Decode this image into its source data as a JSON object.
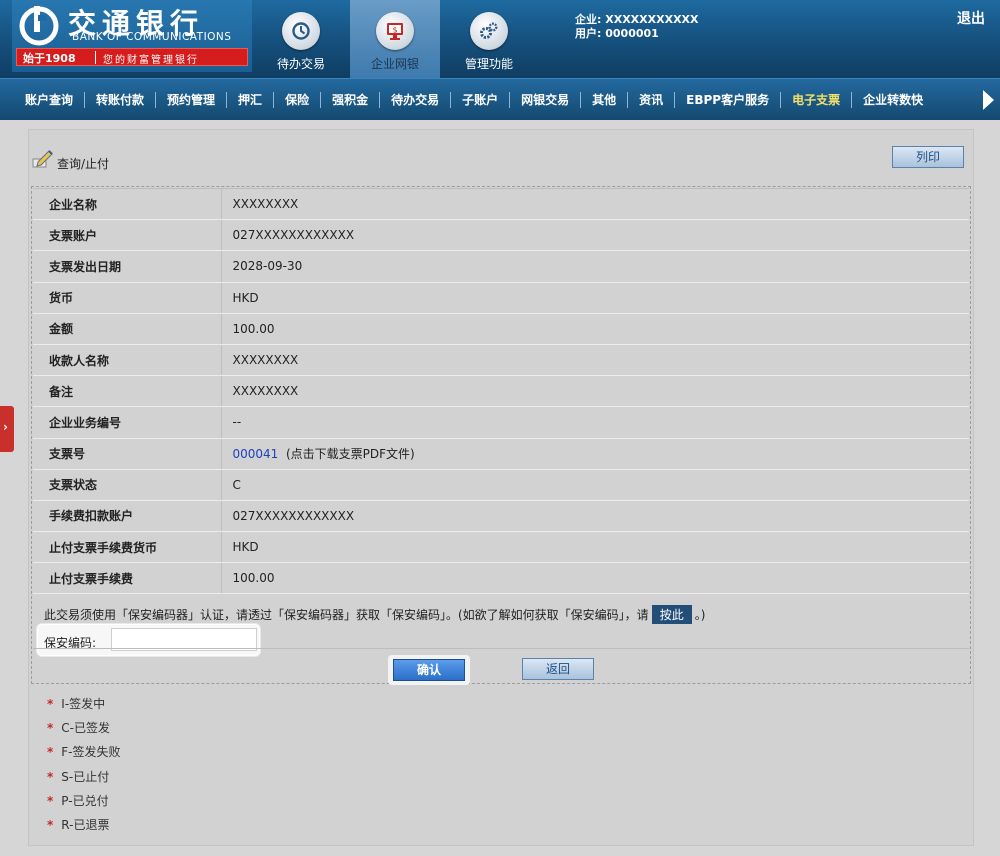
{
  "header": {
    "logo": {
      "cn": "交通银行",
      "en": "BANK OF COMMUNICATIONS",
      "year": "始于1908",
      "slogan": "您的财富管理银行"
    },
    "nav": [
      {
        "label": "待办交易",
        "icon": "clock-icon"
      },
      {
        "label": "企业网银",
        "icon": "monitor-icon"
      },
      {
        "label": "管理功能",
        "icon": "gear-icon"
      }
    ],
    "company_line": "企业: XXXXXXXXXXX",
    "user_line": "用户: 0000001",
    "logout": "退出"
  },
  "menu": {
    "items": [
      "账户查询",
      "转账付款",
      "预约管理",
      "押汇",
      "保险",
      "强积金",
      "待办交易",
      "子账户",
      "网银交易",
      "其他",
      "资讯",
      "EBPP客户服务",
      "电子支票",
      "企业转数快"
    ],
    "active": "电子支票"
  },
  "page": {
    "title": "查询/止付",
    "print": "列印"
  },
  "details": [
    {
      "label": "企业名称",
      "value": "XXXXXXXX"
    },
    {
      "label": "支票账户",
      "value": "027XXXXXXXXXXXX"
    },
    {
      "label": "支票发出日期",
      "value": "2028-09-30"
    },
    {
      "label": "货币",
      "value": "HKD"
    },
    {
      "label": "金额",
      "value": "100.00"
    },
    {
      "label": "收款人名称",
      "value": "XXXXXXXX"
    },
    {
      "label": "备注",
      "value": "XXXXXXXX"
    },
    {
      "label": "企业业务编号",
      "value": "--"
    },
    {
      "label": "支票号",
      "value": "000041",
      "note": "(点击下载支票PDF文件)"
    },
    {
      "label": "支票状态",
      "value": "C"
    },
    {
      "label": "手续费扣款账户",
      "value": "027XXXXXXXXXXXX"
    },
    {
      "label": "止付支票手续费货币",
      "value": "HKD"
    },
    {
      "label": "止付支票手续费",
      "value": "100.00"
    }
  ],
  "security": {
    "notice_before": "此交易须使用「保安编码器」认证，请透过「保安编码器」获取「保安编码」。(如欲了解如何获取「保安编码」，请",
    "click_here": "按此",
    "notice_after": "。)",
    "code_label": "保安编码:",
    "code_value": ""
  },
  "buttons": {
    "confirm": "确认",
    "back": "返回"
  },
  "legend": [
    "I-签发中",
    "C-已签发",
    "F-签发失败",
    "S-已止付",
    "P-已兑付",
    "R-已退票"
  ],
  "colors": {
    "brand_blue": "#154f7c",
    "active_menu": "#f2e06b",
    "link": "#1d3fbf",
    "legend_star": "#c62828"
  }
}
